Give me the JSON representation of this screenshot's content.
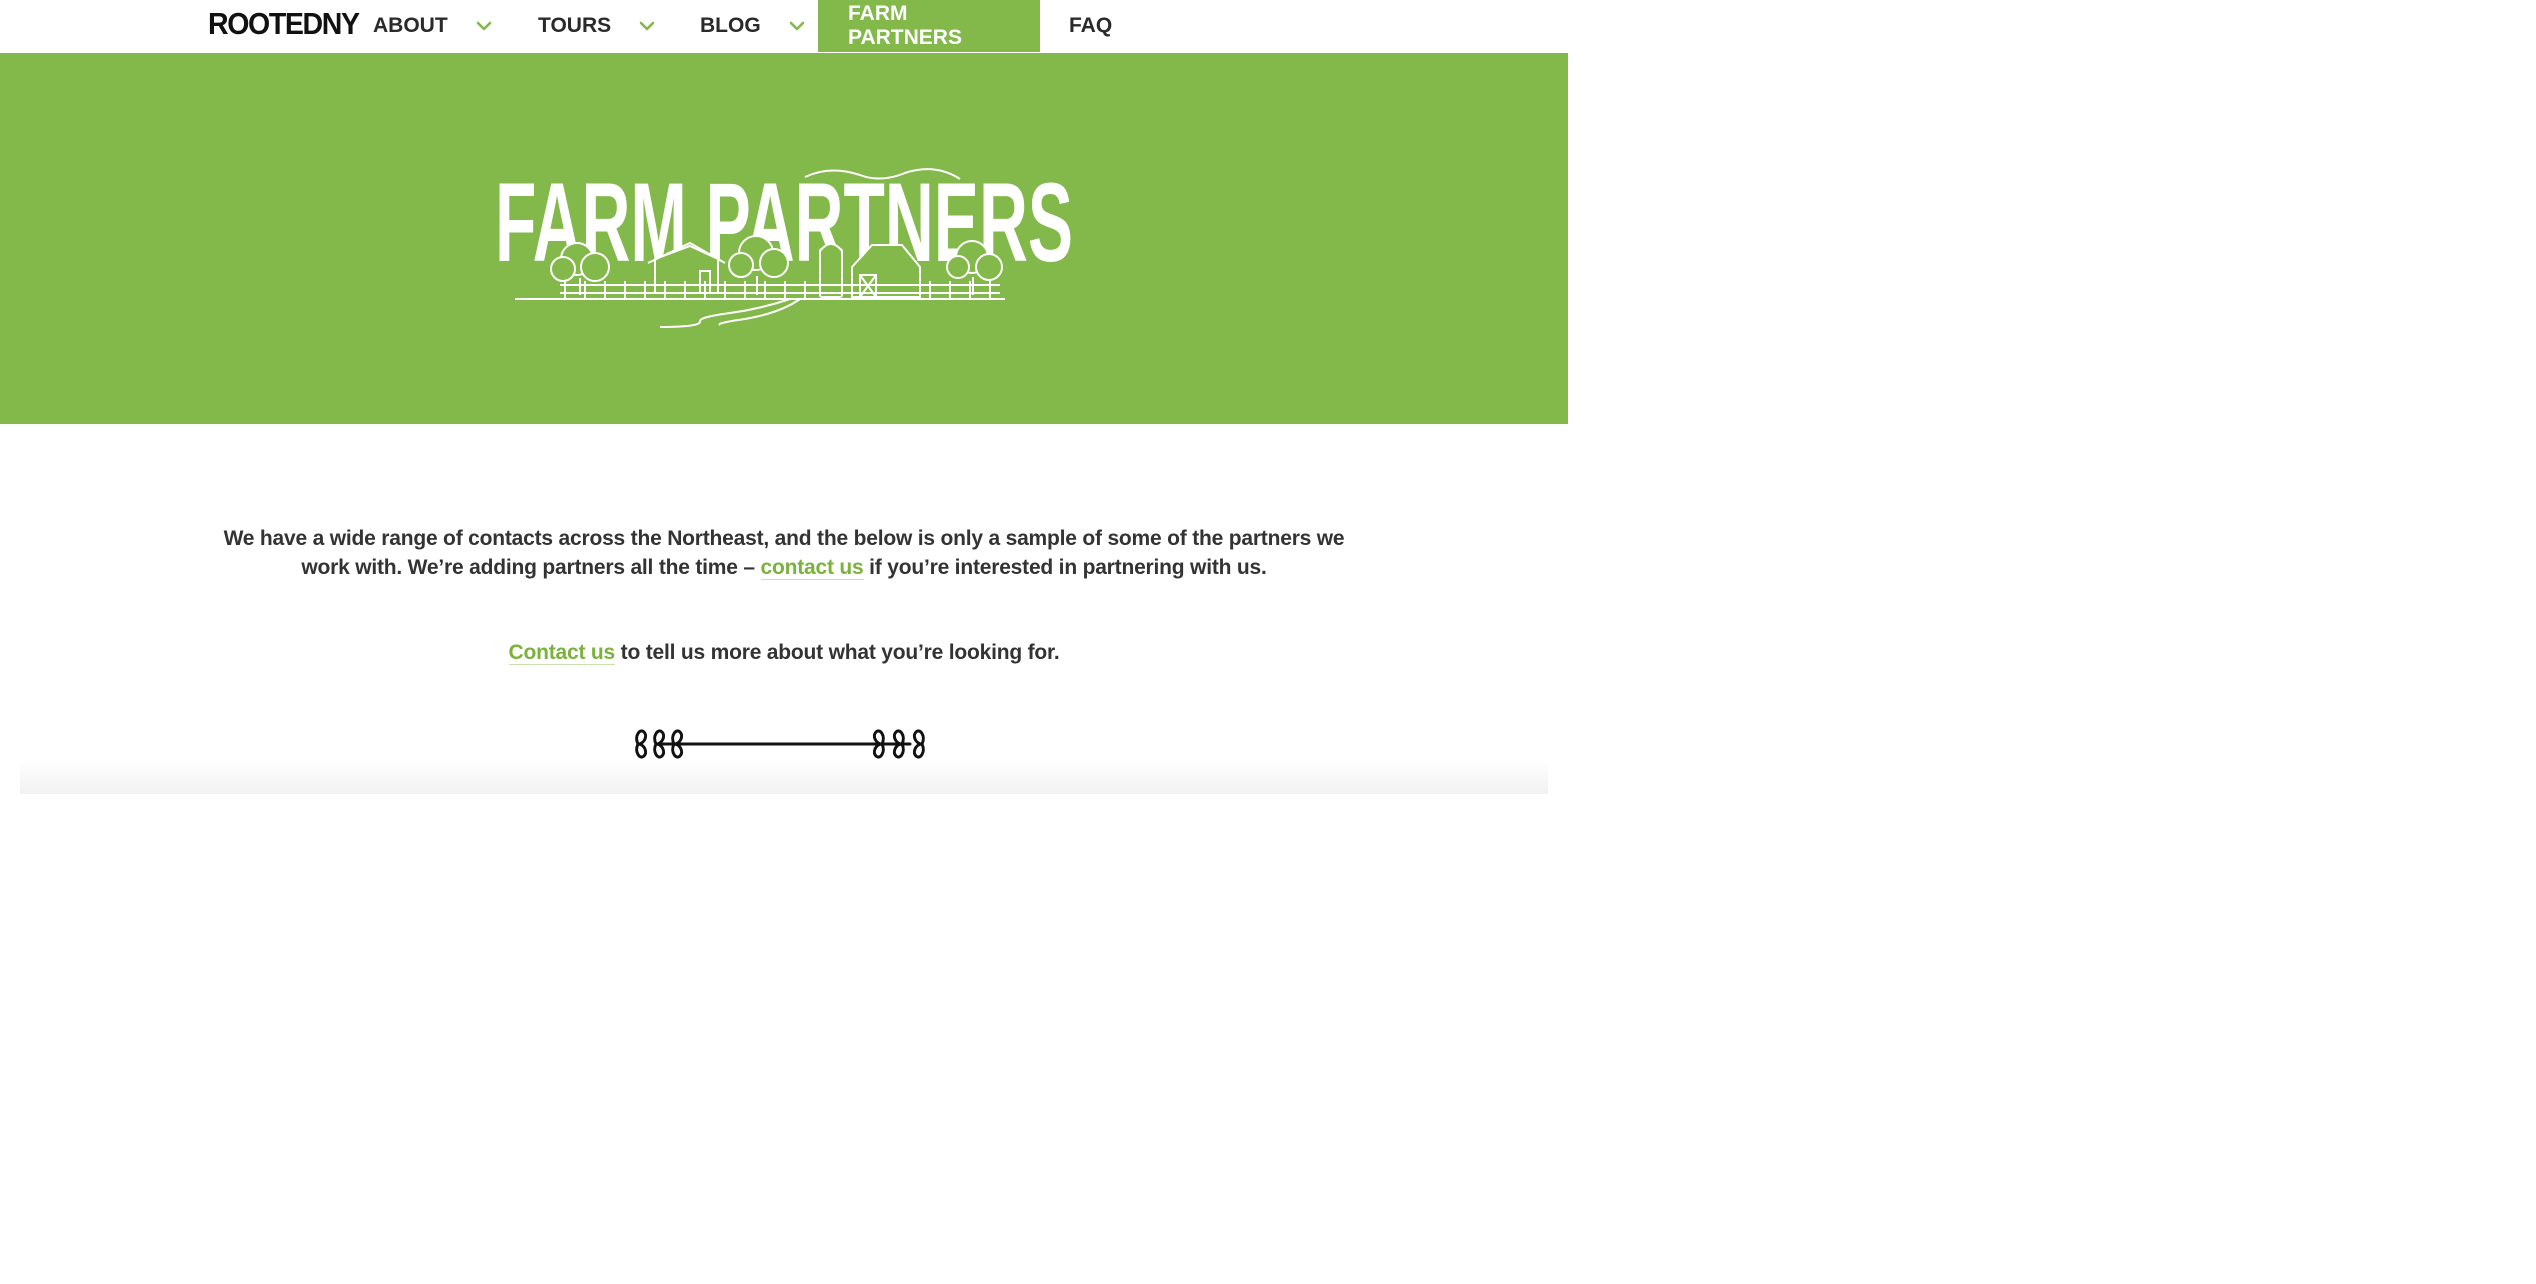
{
  "logo": "ROOTEDNY",
  "nav": {
    "about": "ABOUT",
    "tours": "TOURS",
    "blog": "BLOG",
    "farm_partners": "FARM PARTNERS",
    "faq": "FAQ"
  },
  "hero": {
    "title": "FARM PARTNERS",
    "background_color": "#83b84a"
  },
  "intro": {
    "text_before": "We have a wide range of contacts across the Northeast, and the below is only a sample of some of the partners we work with. We’re adding partners all the time – ",
    "link": "contact us",
    "text_after": " if you’re interested in partnering with us."
  },
  "cta": {
    "link": "Contact us",
    "text_after": " to tell us more about what you’re looking for."
  },
  "colors": {
    "accent": "#83b84a",
    "link": "#7ab23c",
    "text": "#333333"
  },
  "icons": {
    "chevron": "chevron-down-icon",
    "divider": "leaf-divider-icon"
  }
}
